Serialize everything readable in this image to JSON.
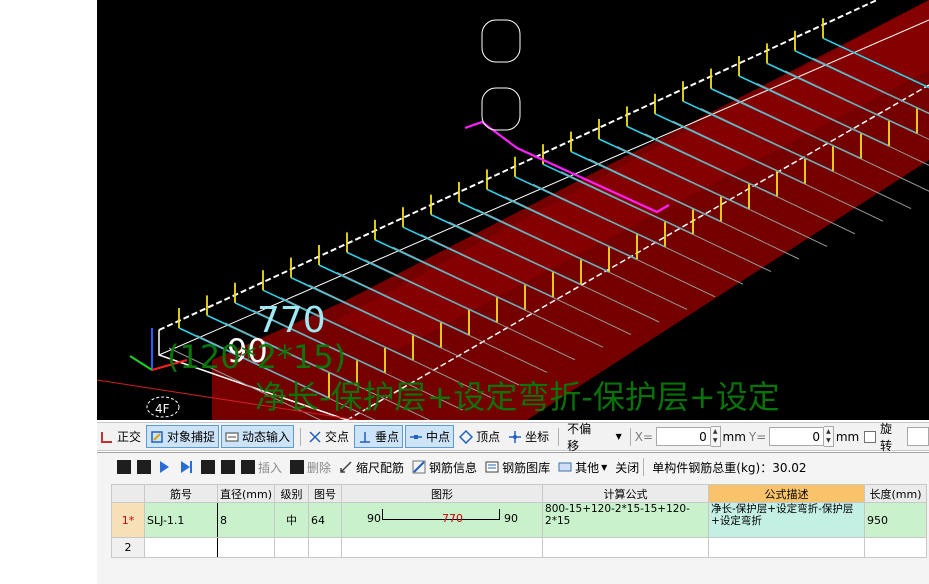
{
  "viewport": {
    "dimension_length": "770",
    "dimension_hook": "90",
    "formula_overlay_line1": "(120*2*15)",
    "formula_overlay_line2": "净长-保护层+设定弯折-保护层+设定",
    "floor_label": "4F"
  },
  "snap_toolbar": {
    "items": {
      "orthogonal": "正交",
      "object_snap": "对象捕捉",
      "dynamic_input": "动态输入",
      "intersection": "交点",
      "perpendicular": "垂点",
      "midpoint": "中点",
      "vertex": "顶点",
      "coordinate": "坐标"
    },
    "offset_mode": "不偏移",
    "x_label": "X=",
    "x_value": "0",
    "x_unit": "mm",
    "y_label": "Y=",
    "y_value": "0",
    "y_unit": "mm",
    "rotate_label": "旋转"
  },
  "rebar_toolbar": {
    "insert": "插入",
    "delete": "删除",
    "scale_rebar": "缩尺配筋",
    "rebar_info": "钢筋信息",
    "rebar_library": "钢筋图库",
    "other": "其他",
    "close": "关闭",
    "total_weight": "单构件钢筋总重(kg)：30.02"
  },
  "table": {
    "headers": [
      "",
      "筋号",
      "直径(mm)",
      "级别",
      "图号",
      "图形",
      "计算公式",
      "公式描述",
      "长度(mm)"
    ],
    "rows": [
      {
        "num": "1*",
        "bar_no": "SLJ-1.1",
        "diameter": "8",
        "grade": "中",
        "shape_no": "64",
        "shape_left": "90",
        "shape_mid": "770",
        "shape_right": "90",
        "formula": "800-15+120-2*15-15+120-2*15",
        "description": "净长-保护层+设定弯折-保护层+设定弯折",
        "length": "950"
      },
      {
        "num": "2",
        "bar_no": "",
        "diameter": "",
        "grade": "",
        "shape_no": "",
        "shape_left": "",
        "shape_mid": "",
        "shape_right": "",
        "formula": "",
        "description": "",
        "length": ""
      }
    ]
  },
  "colors": {
    "viewport_bg": "#000000",
    "beam_fill": "#7a0000",
    "stirrup": "#2fd0e8",
    "hook": "#f0e020",
    "selected_bar": "#ff20ff",
    "formula_overlay": "#0a7a0a",
    "selected_row": "#c9f2cc",
    "formula_desc_header": "#f8c36a"
  }
}
